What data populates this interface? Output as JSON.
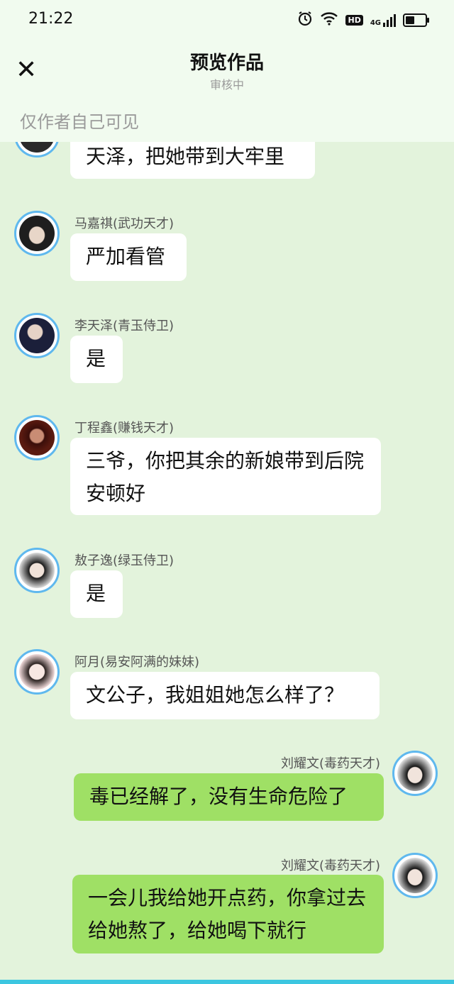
{
  "status_bar": {
    "time": "21:22",
    "hd": "HD",
    "network": "4G"
  },
  "header": {
    "close_icon": "close-icon",
    "title": "预览作品",
    "subtitle": "审核中",
    "visibility_note": "仅作者自己可见"
  },
  "messages": [
    {
      "side": "left",
      "sender": "",
      "text": "天泽，把她带到大牢里"
    },
    {
      "side": "left",
      "sender": "马嘉祺(武功天才)",
      "text": "严加看管"
    },
    {
      "side": "left",
      "sender": "李天泽(青玉侍卫)",
      "text": "是"
    },
    {
      "side": "left",
      "sender": "丁程鑫(赚钱天才)",
      "text": "三爷，你把其余的新娘带到后院安顿好"
    },
    {
      "side": "left",
      "sender": "敖子逸(绿玉侍卫)",
      "text": "是"
    },
    {
      "side": "left",
      "sender": "阿月(易安阿满的妹妹)",
      "text": "文公子，我姐姐她怎么样了？"
    },
    {
      "side": "right",
      "sender": "刘耀文(毒药天才)",
      "text": "毒已经解了，没有生命危险了"
    },
    {
      "side": "right",
      "sender": "刘耀文(毒药天才)",
      "text": "一会儿我给她开点药，你拿过去给她熬了，给她喝下就行"
    }
  ],
  "colors": {
    "incoming_bubble": "#ffffff",
    "outgoing_bubble": "#9fe065",
    "avatar_ring": "#5fb8ee",
    "background": "#e3f3dc"
  }
}
